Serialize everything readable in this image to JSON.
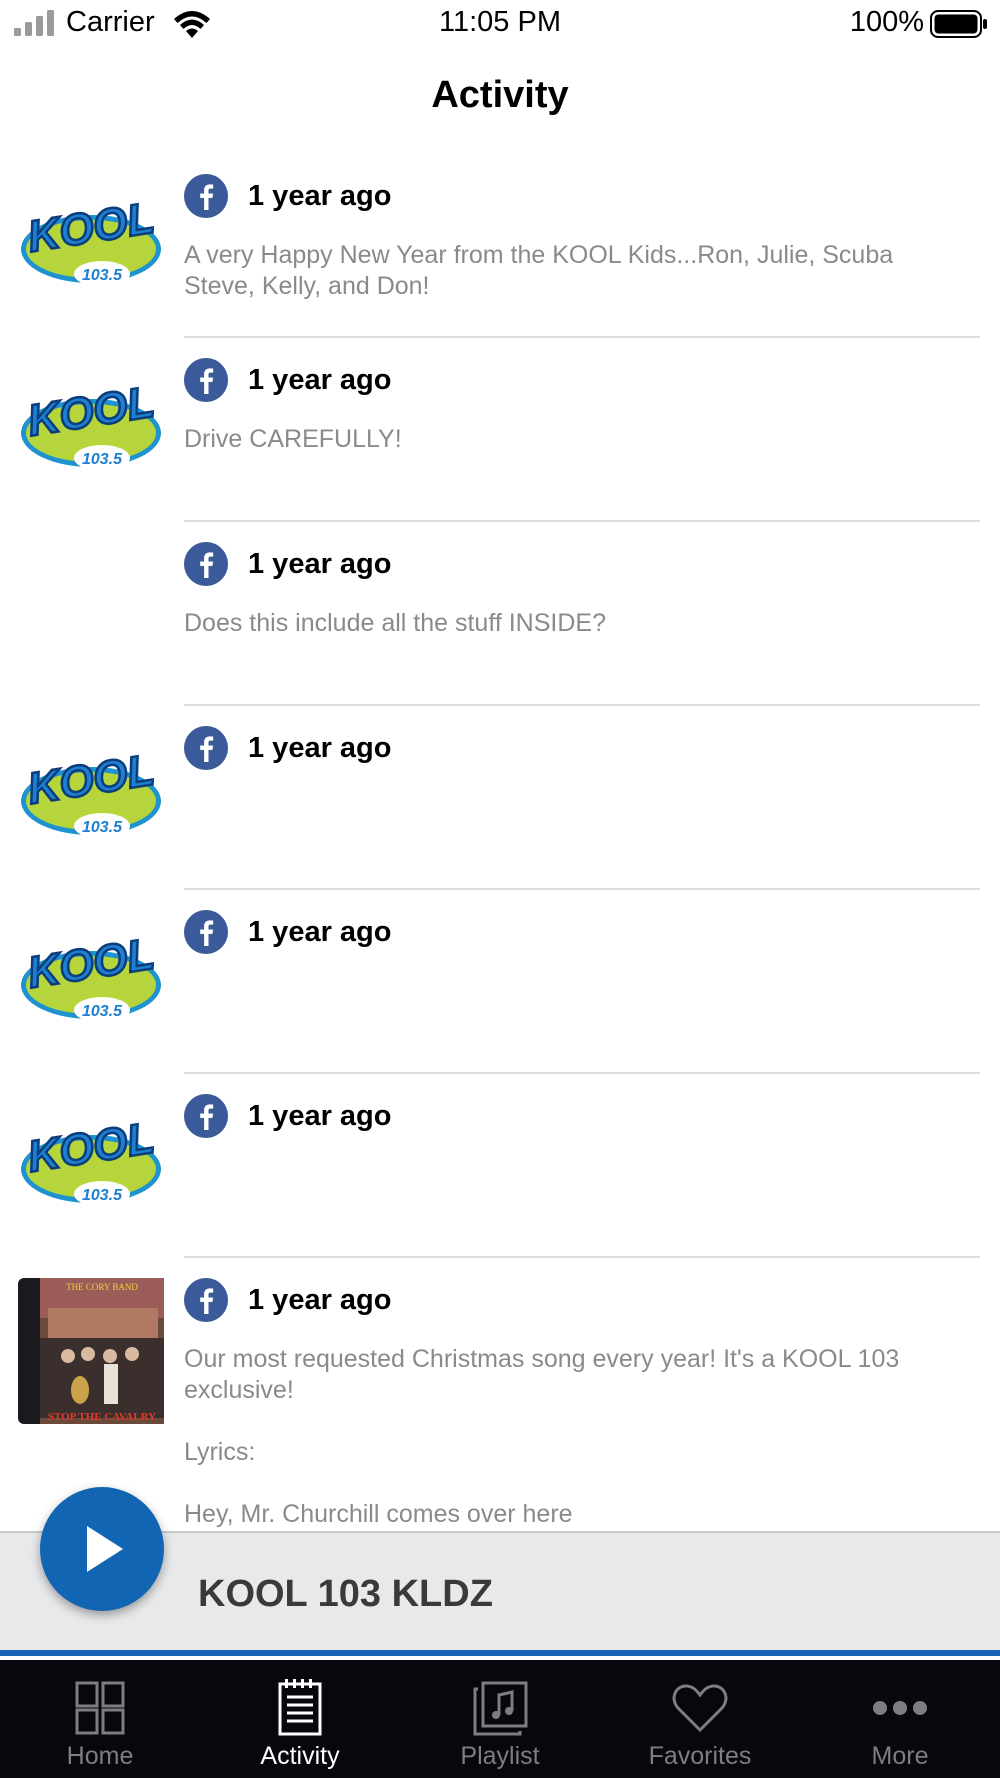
{
  "status_bar": {
    "carrier": "Carrier",
    "time": "11:05 PM",
    "battery": "100%"
  },
  "header": {
    "title": "Activity"
  },
  "feed": [
    {
      "thumb": "kool-logo",
      "source_icon": "facebook-icon",
      "time": "1 year ago",
      "text": "A very Happy New Year from the KOOL Kids...Ron, Julie, Scuba Steve, Kelly, and Don!"
    },
    {
      "thumb": "kool-logo",
      "source_icon": "facebook-icon",
      "time": "1 year ago",
      "text": "Drive CAREFULLY!"
    },
    {
      "thumb": "none",
      "source_icon": "facebook-icon",
      "time": "1 year ago",
      "text": "Does this include all the stuff INSIDE?"
    },
    {
      "thumb": "kool-logo",
      "source_icon": "facebook-icon",
      "time": "1 year ago",
      "text": ""
    },
    {
      "thumb": "kool-logo",
      "source_icon": "facebook-icon",
      "time": "1 year ago",
      "text": ""
    },
    {
      "thumb": "kool-logo",
      "source_icon": "facebook-icon",
      "time": "1 year ago",
      "text": ""
    },
    {
      "thumb": "album-cover",
      "source_icon": "facebook-icon",
      "time": "1 year ago",
      "text": "Our most requested Christmas song every year!  It's a KOOL 103 exclusive!\n\nLyrics:\n\nHey, Mr. Churchill comes over here"
    }
  ],
  "logo": {
    "word": "KOOL",
    "frequency": "103.5"
  },
  "album": {
    "top_text": "THE CORY BAND",
    "bottom_text": "STOP THE CAVALRY"
  },
  "player": {
    "station": "KOOL 103 KLDZ",
    "play_icon": "play-icon"
  },
  "tabs": [
    {
      "label": "Home",
      "icon": "home-grid-icon",
      "active": false
    },
    {
      "label": "Activity",
      "icon": "activity-notepad-icon",
      "active": true
    },
    {
      "label": "Playlist",
      "icon": "playlist-music-icon",
      "active": false
    },
    {
      "label": "Favorites",
      "icon": "heart-icon",
      "active": false
    },
    {
      "label": "More",
      "icon": "more-dots-icon",
      "active": false
    }
  ],
  "colors": {
    "facebook": "#3b5a9a",
    "player_blue": "#1265b3",
    "tab_bar": "#08070d",
    "text_secondary": "#8a8a8e"
  }
}
